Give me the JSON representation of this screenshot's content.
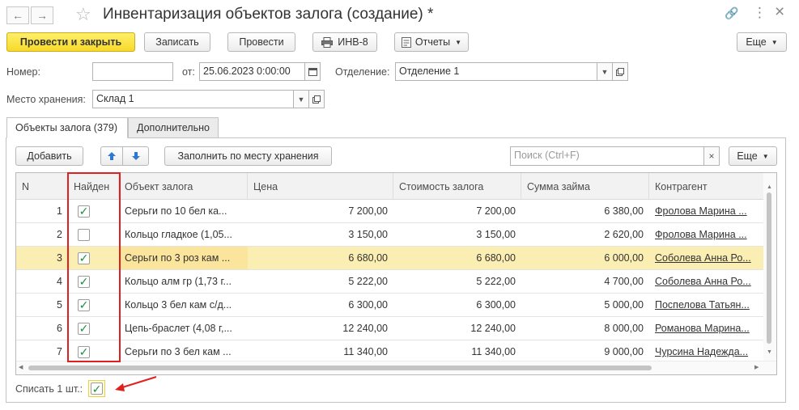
{
  "window": {
    "title": "Инвентаризация объектов залога (создание) *",
    "back_glyph": "←",
    "forward_glyph": "→",
    "favorite_glyph": "☆",
    "link_glyph": "🔗",
    "more_glyph": "⋮",
    "close_glyph": "×"
  },
  "toolbar": {
    "post_and_close": "Провести и закрыть",
    "save": "Записать",
    "post": "Провести",
    "print_inv8": "ИНВ-8",
    "reports": "Отчеты",
    "more": "Еще"
  },
  "header_fields": {
    "number_label": "Номер:",
    "number_value": "",
    "date_label": "от:",
    "date_value": "25.06.2023  0:00:00",
    "branch_label": "Отделение:",
    "branch_value": "Отделение 1",
    "storage_label": "Место хранения:",
    "storage_value": "Склад 1"
  },
  "tabs": [
    {
      "label": "Объекты залога (379)",
      "active": true
    },
    {
      "label": "Дополнительно",
      "active": false
    }
  ],
  "table_toolbar": {
    "add": "Добавить",
    "fill_by_storage": "Заполнить по месту хранения",
    "search_placeholder": "Поиск (Ctrl+F)",
    "more": "Еще"
  },
  "table": {
    "columns": [
      "N",
      "Найден",
      "Объект залога",
      "Цена",
      "Стоимость залога",
      "Сумма займа",
      "Контрагент"
    ],
    "rows": [
      {
        "n": "1",
        "found": true,
        "object": "Серьги по 10 бел ка...",
        "price": "7 200,00",
        "pledge_value": "7 200,00",
        "loan": "6 380,00",
        "counterparty": "Фролова Марина ..."
      },
      {
        "n": "2",
        "found": false,
        "object": "Кольцо гладкое (1,05...",
        "price": "3 150,00",
        "pledge_value": "3 150,00",
        "loan": "2 620,00",
        "counterparty": "Фролова Марина ..."
      },
      {
        "n": "3",
        "found": true,
        "object": "Серьги по 3 роз кам ...",
        "price": "6 680,00",
        "pledge_value": "6 680,00",
        "loan": "6 000,00",
        "counterparty": "Соболева Анна Ро..."
      },
      {
        "n": "4",
        "found": true,
        "object": "Кольцо алм гр (1,73 г...",
        "price": "5 222,00",
        "pledge_value": "5 222,00",
        "loan": "4 700,00",
        "counterparty": "Соболева Анна Ро..."
      },
      {
        "n": "5",
        "found": true,
        "object": "Кольцо 3 бел кам с/д...",
        "price": "6 300,00",
        "pledge_value": "6 300,00",
        "loan": "5 000,00",
        "counterparty": "Поспелова Татьян..."
      },
      {
        "n": "6",
        "found": true,
        "object": "Цепь-браслет (4,08 г,...",
        "price": "12 240,00",
        "pledge_value": "12 240,00",
        "loan": "8 000,00",
        "counterparty": "Романова Марина..."
      },
      {
        "n": "7",
        "found": true,
        "object": "Серьги по 3 бел кам ...",
        "price": "11 340,00",
        "pledge_value": "11 340,00",
        "loan": "9 000,00",
        "counterparty": "Чурсина Надежда..."
      }
    ],
    "selected_row": 2
  },
  "footer": {
    "write_off_label": "Списать 1 шт.:",
    "write_off_checked": true
  },
  "colors": {
    "primary_button": "#f7d92a",
    "highlight_box": "#e02020",
    "selected_row": "#fbeeb3",
    "checkmark": "#1a8f3c"
  }
}
